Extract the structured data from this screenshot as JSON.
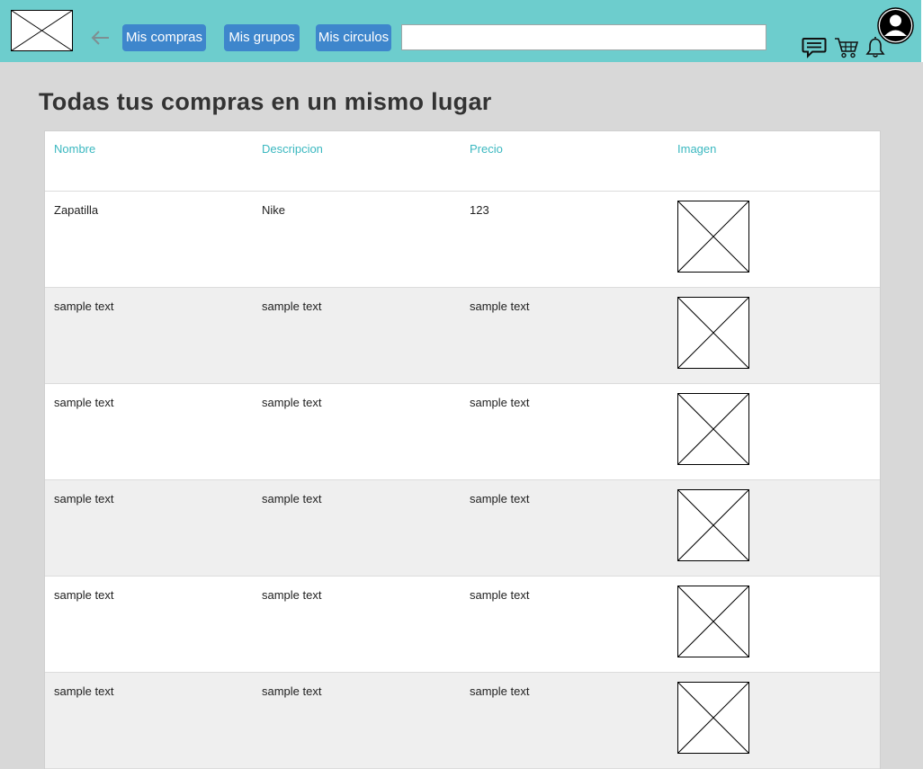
{
  "header": {
    "nav_buttons": [
      {
        "label": "Mis compras"
      },
      {
        "label": "Mis grupos"
      },
      {
        "label": "Mis circulos"
      }
    ],
    "search": {
      "value": "",
      "placeholder": ""
    },
    "icons": [
      "back-arrow-icon",
      "chat-icon",
      "cart-icon",
      "bell-icon",
      "user-avatar-icon"
    ],
    "accent_color": "#6dcdcd",
    "button_color": "#3e86cc"
  },
  "main": {
    "title": "Todas tus compras en un mismo lugar",
    "table": {
      "columns": [
        "Nombre",
        "Descripcion",
        "Precio",
        "Imagen"
      ],
      "rows": [
        {
          "nombre": "Zapatilla",
          "descripcion": "Nike",
          "precio": "123"
        },
        {
          "nombre": "sample text",
          "descripcion": "sample text",
          "precio": "sample text"
        },
        {
          "nombre": "sample text",
          "descripcion": "sample text",
          "precio": "sample text"
        },
        {
          "nombre": "sample text",
          "descripcion": "sample text",
          "precio": "sample text"
        },
        {
          "nombre": "sample text",
          "descripcion": "sample text",
          "precio": "sample text"
        },
        {
          "nombre": "sample text",
          "descripcion": "sample text",
          "precio": "sample text"
        }
      ],
      "header_text_color": "#3bb8c0",
      "alt_row_color": "#efefef"
    }
  }
}
